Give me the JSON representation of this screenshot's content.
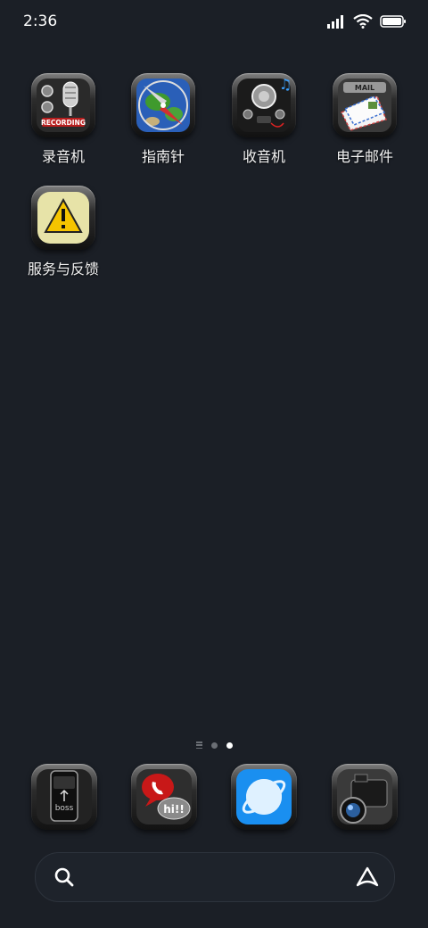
{
  "status_bar": {
    "time": "2:36",
    "icons": [
      "signal-icon",
      "wifi-icon",
      "battery-icon"
    ]
  },
  "apps": [
    {
      "label": "录音机",
      "icon": "recorder-icon",
      "badge_text": "RECORDING"
    },
    {
      "label": "指南针",
      "icon": "compass-icon"
    },
    {
      "label": "收音机",
      "icon": "radio-icon"
    },
    {
      "label": "电子邮件",
      "icon": "email-icon",
      "badge_text": "MAIL"
    },
    {
      "label": "服务与反馈",
      "icon": "service-feedback-icon"
    }
  ],
  "page_indicator": {
    "pages": 2,
    "current": 2
  },
  "dock": [
    {
      "icon": "phone-boss-icon",
      "text": "boss"
    },
    {
      "icon": "messages-icon",
      "text": "hi!!"
    },
    {
      "icon": "browser-icon"
    },
    {
      "icon": "camera-icon"
    }
  ],
  "search": {
    "placeholder": ""
  },
  "colors": {
    "background": "#1b1f26",
    "active_dot": "#ffffff",
    "inactive_dot": "#6b6f75"
  }
}
